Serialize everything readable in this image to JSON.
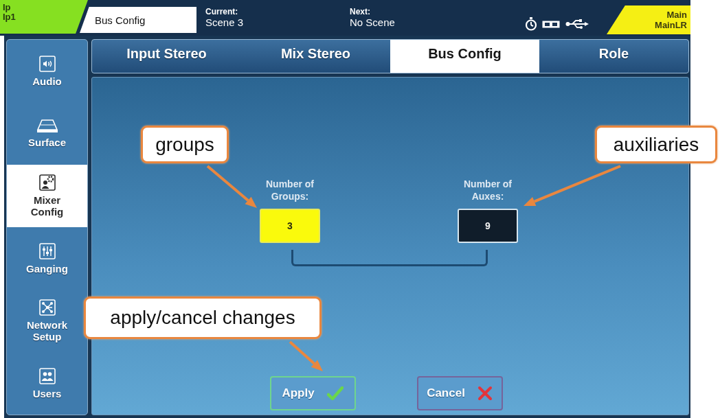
{
  "status_bar": {
    "user_short": "Ip",
    "user": "Ip1",
    "page": "Bus Config",
    "current_label": "Current:",
    "current": "Scene 3",
    "next_label": "Next:",
    "next": "No Scene",
    "mix_label": "Main",
    "mix": "MainLR"
  },
  "sidebar": {
    "items": [
      {
        "label": "Audio",
        "selected": false
      },
      {
        "label": "Surface",
        "selected": false
      },
      {
        "label": "Mixer Config",
        "selected": true
      },
      {
        "label": "Ganging",
        "selected": false
      },
      {
        "label": "Network Setup",
        "selected": false
      },
      {
        "label": "Users",
        "selected": false
      }
    ]
  },
  "tabs": [
    {
      "label": "Input Stereo",
      "selected": false
    },
    {
      "label": "Mix Stereo",
      "selected": false
    },
    {
      "label": "Bus Config",
      "selected": true
    },
    {
      "label": "Role",
      "selected": false
    }
  ],
  "fields": [
    {
      "label": "Number of Groups:",
      "value": "3",
      "selected": true
    },
    {
      "label": "Number of Auxes:",
      "value": "9",
      "selected": false
    }
  ],
  "buttons": [
    {
      "label": "Apply",
      "kind": "apply"
    },
    {
      "label": "Cancel",
      "kind": "cancel"
    }
  ],
  "callouts": [
    {
      "text": "groups"
    },
    {
      "text": "auxiliaries"
    },
    {
      "text": "apply/cancel changes"
    }
  ]
}
